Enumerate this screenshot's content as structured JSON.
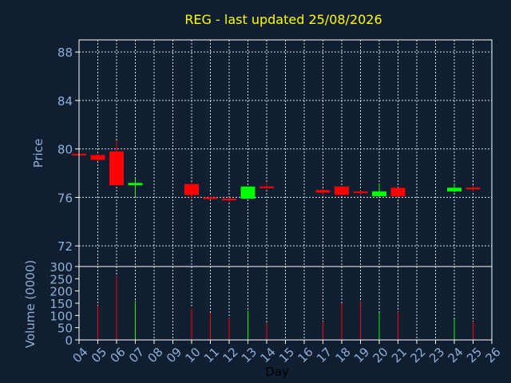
{
  "chart_data": {
    "type": "candlestick",
    "title": "REG - last updated 25/08/2026",
    "xlabel": "Day",
    "price_panel": {
      "ylabel": "Price",
      "ylim": [
        70.3,
        89.0
      ],
      "yticks": [
        72,
        76,
        80,
        84,
        88
      ]
    },
    "volume_panel": {
      "ylabel": "Volume (0000)",
      "ylim": [
        0,
        300
      ],
      "yticks": [
        0,
        50,
        100,
        150,
        200,
        250,
        300
      ]
    },
    "x_ticks": [
      "04",
      "05",
      "06",
      "07",
      "08",
      "09",
      "10",
      "11",
      "12",
      "13",
      "14",
      "15",
      "16",
      "17",
      "18",
      "19",
      "20",
      "21",
      "22",
      "23",
      "24",
      "25",
      "26"
    ],
    "candles": [
      {
        "day": 4,
        "open": 79.6,
        "close": 79.5,
        "high": 79.6,
        "low": 79.5,
        "volume": 0
      },
      {
        "day": 5,
        "open": 79.5,
        "close": 79.1,
        "high": 79.6,
        "low": 79.0,
        "volume": 140
      },
      {
        "day": 6,
        "open": 79.8,
        "close": 77.0,
        "high": 80.7,
        "low": 77.0,
        "volume": 260
      },
      {
        "day": 7,
        "open": 77.0,
        "close": 77.2,
        "high": 77.6,
        "low": 76.1,
        "volume": 160
      },
      {
        "day": 10,
        "open": 77.1,
        "close": 76.2,
        "high": 77.3,
        "low": 75.9,
        "volume": 130
      },
      {
        "day": 11,
        "open": 76.0,
        "close": 75.9,
        "high": 76.1,
        "low": 75.8,
        "volume": 110
      },
      {
        "day": 12,
        "open": 75.9,
        "close": 75.8,
        "high": 76.0,
        "low": 75.6,
        "volume": 90
      },
      {
        "day": 13,
        "open": 75.9,
        "close": 76.9,
        "high": 76.9,
        "low": 75.9,
        "volume": 120
      },
      {
        "day": 14,
        "open": 76.9,
        "close": 76.8,
        "high": 77.2,
        "low": 76.7,
        "volume": 70
      },
      {
        "day": 17,
        "open": 76.6,
        "close": 76.4,
        "high": 76.7,
        "low": 76.2,
        "volume": 75
      },
      {
        "day": 18,
        "open": 76.9,
        "close": 76.2,
        "high": 76.9,
        "low": 76.2,
        "volume": 150
      },
      {
        "day": 19,
        "open": 76.5,
        "close": 76.4,
        "high": 76.6,
        "low": 76.2,
        "volume": 155
      },
      {
        "day": 20,
        "open": 76.1,
        "close": 76.5,
        "high": 77.1,
        "low": 76.1,
        "volume": 110
      },
      {
        "day": 21,
        "open": 76.8,
        "close": 76.1,
        "high": 76.8,
        "low": 76.0,
        "volume": 115
      },
      {
        "day": 24,
        "open": 76.5,
        "close": 76.8,
        "high": 77.1,
        "low": 76.4,
        "volume": 85
      },
      {
        "day": 25,
        "open": 76.8,
        "close": 76.7,
        "high": 77.0,
        "low": 76.5,
        "volume": 75
      }
    ],
    "grid": true,
    "colors": {
      "background": "#0f1e30",
      "up": "#00ff00",
      "down": "#ff0000",
      "title": "#ffff00",
      "axis_text": "#8fb0d6",
      "frame": "#ffffff"
    }
  }
}
